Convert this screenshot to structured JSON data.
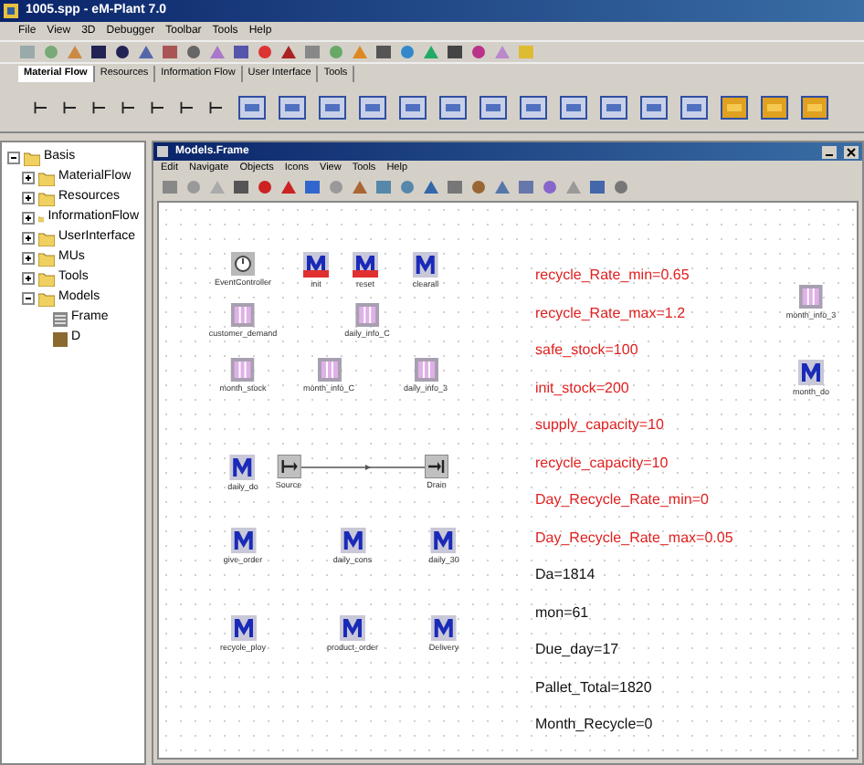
{
  "window": {
    "title": "1005.spp - eM-Plant 7.0"
  },
  "menu": [
    "File",
    "View",
    "3D",
    "Debugger",
    "Toolbar",
    "Tools",
    "Help"
  ],
  "tabs": [
    {
      "label": "Material Flow",
      "selected": true
    },
    {
      "label": "Resources",
      "selected": false
    },
    {
      "label": "Information Flow",
      "selected": false
    },
    {
      "label": "User Interface",
      "selected": false
    },
    {
      "label": "Tools",
      "selected": false
    }
  ],
  "tree": [
    {
      "label": "Basis",
      "expanded": true,
      "children": [
        {
          "label": "MaterialFlow",
          "expanded": false
        },
        {
          "label": "Resources",
          "expanded": false
        },
        {
          "label": "InformationFlow",
          "expanded": false
        },
        {
          "label": "UserInterface",
          "expanded": false
        },
        {
          "label": "MUs",
          "expanded": false
        },
        {
          "label": "Tools",
          "expanded": false
        },
        {
          "label": "Models",
          "expanded": true,
          "children": [
            {
              "label": "Frame",
              "kind": "frame"
            },
            {
              "label": "D",
              "kind": "object"
            }
          ]
        }
      ]
    }
  ],
  "frame": {
    "title": "Models.Frame",
    "menu": [
      "Edit",
      "Navigate",
      "Objects",
      "Icons",
      "View",
      "Tools",
      "Help"
    ],
    "objects": [
      {
        "kind": "event",
        "label": "EventController"
      },
      {
        "kind": "method_red",
        "label": "init"
      },
      {
        "kind": "method_red",
        "label": "reset"
      },
      {
        "kind": "method",
        "label": "clearall"
      },
      {
        "kind": "table",
        "label": "customer_demand"
      },
      {
        "kind": "table",
        "label": "daily_info_C"
      },
      {
        "kind": "table",
        "label": "month_stock"
      },
      {
        "kind": "table",
        "label": "month_info_C"
      },
      {
        "kind": "table",
        "label": "daily_info_3"
      },
      {
        "kind": "method",
        "label": "daily_do"
      },
      {
        "kind": "source",
        "label": "Source"
      },
      {
        "kind": "drain",
        "label": "Drain"
      },
      {
        "kind": "method",
        "label": "give_order"
      },
      {
        "kind": "method",
        "label": "daily_cons"
      },
      {
        "kind": "method",
        "label": "daily_30"
      },
      {
        "kind": "method",
        "label": "recycle_ploy"
      },
      {
        "kind": "method",
        "label": "product_order"
      },
      {
        "kind": "method",
        "label": "Delivery"
      },
      {
        "kind": "table",
        "label": "month_info_3"
      },
      {
        "kind": "method",
        "label": "month_do"
      }
    ],
    "variables": [
      {
        "text": "recycle_Rate_min=0.65",
        "color": "#e02020"
      },
      {
        "text": "recycle_Rate_max=1.2",
        "color": "#e02020"
      },
      {
        "text": "safe_stock=100",
        "color": "#e02020"
      },
      {
        "text": "init_stock=200",
        "color": "#e02020"
      },
      {
        "text": "supply_capacity=10",
        "color": "#e02020"
      },
      {
        "text": "recycle_capacity=10",
        "color": "#e02020"
      },
      {
        "text": "Day_Recycle_Rate_min=0",
        "color": "#e02020"
      },
      {
        "text": "Day_Recycle_Rate_max=0.05",
        "color": "#e02020"
      },
      {
        "text": "Da=1814",
        "color": "#111111"
      },
      {
        "text": "mon=61",
        "color": "#111111"
      },
      {
        "text": "Due_day=17",
        "color": "#111111"
      },
      {
        "text": "Pallet_Total=1820",
        "color": "#111111"
      },
      {
        "text": "Month_Recycle=0",
        "color": "#111111"
      }
    ]
  }
}
